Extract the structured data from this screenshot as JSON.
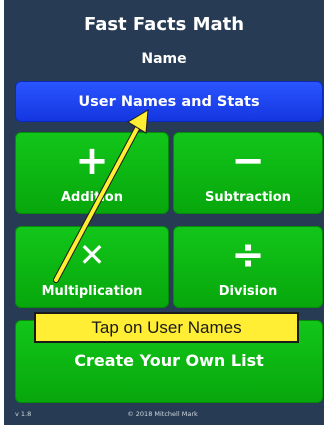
{
  "header": {
    "title": "Fast Facts Math",
    "subtitle": "Name"
  },
  "users_button": {
    "label": "User Names and Stats"
  },
  "operations": [
    {
      "symbol": "+",
      "label": "Addition"
    },
    {
      "symbol": "−",
      "label": "Subtraction"
    },
    {
      "symbol": "✕",
      "label": "Multiplication"
    },
    {
      "symbol": "÷",
      "label": "Division"
    }
  ],
  "custom_list": {
    "label": "Create Your Own List"
  },
  "tooltip": {
    "text": "Tap on User Names"
  },
  "footer": {
    "version": "v 1.8",
    "copyright": "© 2018 Mitchell Mark"
  },
  "colors": {
    "background": "#273c54",
    "blue_button": "#1a44f5",
    "green_button": "#0bb811",
    "tooltip": "#ffee33",
    "arrow": "#ffee33"
  }
}
